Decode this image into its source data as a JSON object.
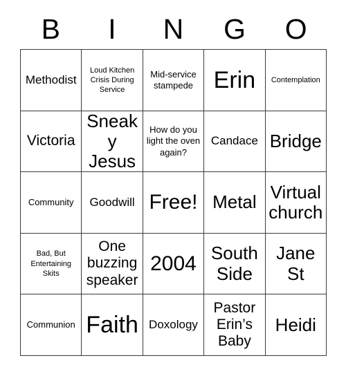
{
  "card": {
    "title": "BINGO",
    "headers": [
      "B",
      "I",
      "N",
      "G",
      "O"
    ],
    "free_space": "Free!",
    "rows": [
      [
        {
          "text": "Methodist",
          "size": "md"
        },
        {
          "text": "Loud Kitchen Crisis During Service",
          "size": "xs"
        },
        {
          "text": "Mid-service stampede",
          "size": "sm"
        },
        {
          "text": "Erin",
          "size": "huge"
        },
        {
          "text": "Contemplation",
          "size": "xs"
        }
      ],
      [
        {
          "text": "Victoria",
          "size": "lg"
        },
        {
          "text": "Sneaky Jesus",
          "size": "xl"
        },
        {
          "text": "How do you light the oven again?",
          "size": "sm"
        },
        {
          "text": "Candace",
          "size": "md"
        },
        {
          "text": "Bridge",
          "size": "xl"
        }
      ],
      [
        {
          "text": "Community",
          "size": "sm"
        },
        {
          "text": "Goodwill",
          "size": "md"
        },
        {
          "text": "Free!",
          "size": "xxl"
        },
        {
          "text": "Metal",
          "size": "xl"
        },
        {
          "text": "Virtual church",
          "size": "xl"
        }
      ],
      [
        {
          "text": "Bad, But Entertaining Skits",
          "size": "xs"
        },
        {
          "text": "One buzzing speaker",
          "size": "lg"
        },
        {
          "text": "2004",
          "size": "xxl"
        },
        {
          "text": "South Side",
          "size": "xl"
        },
        {
          "text": "Jane St",
          "size": "xl"
        }
      ],
      [
        {
          "text": "Communion",
          "size": "sm"
        },
        {
          "text": "Faith",
          "size": "huge"
        },
        {
          "text": "Doxology",
          "size": "md"
        },
        {
          "text": "Pastor Erin’s Baby",
          "size": "lg"
        },
        {
          "text": "Heidi",
          "size": "xl"
        }
      ]
    ]
  },
  "colors": {
    "background": "#ffffff",
    "text": "#000000",
    "grid_line": "#3a3a3a"
  }
}
